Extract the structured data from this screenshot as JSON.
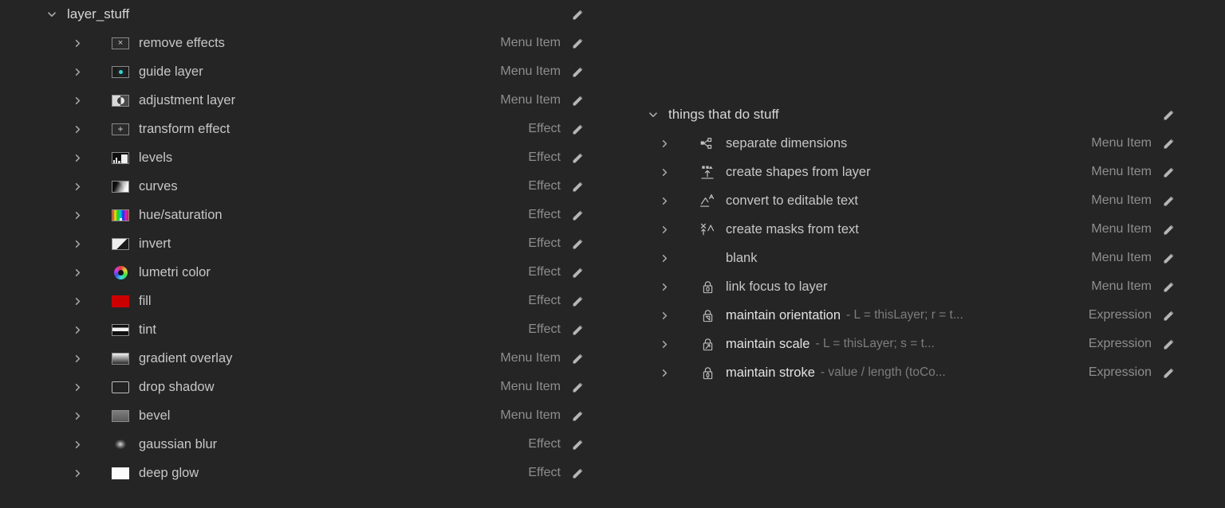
{
  "groups": {
    "left": {
      "name": "layer_stuff",
      "expanded": true,
      "edit_icon": "pencil-icon",
      "items": [
        {
          "label": "remove effects",
          "kind": "Menu Item",
          "icon": "remove-effects-icon"
        },
        {
          "label": "guide layer",
          "kind": "Menu Item",
          "icon": "guide-layer-icon"
        },
        {
          "label": "adjustment layer",
          "kind": "Menu Item",
          "icon": "adjustment-layer-icon"
        },
        {
          "label": "transform effect",
          "kind": "Effect",
          "icon": "transform-effect-icon"
        },
        {
          "label": "levels",
          "kind": "Effect",
          "icon": "levels-icon"
        },
        {
          "label": "curves",
          "kind": "Effect",
          "icon": "curves-icon"
        },
        {
          "label": "hue/saturation",
          "kind": "Effect",
          "icon": "hue-saturation-icon"
        },
        {
          "label": "invert",
          "kind": "Effect",
          "icon": "invert-icon"
        },
        {
          "label": "lumetri color",
          "kind": "Effect",
          "icon": "lumetri-color-icon"
        },
        {
          "label": "fill",
          "kind": "Effect",
          "icon": "fill-icon"
        },
        {
          "label": "tint",
          "kind": "Effect",
          "icon": "tint-icon"
        },
        {
          "label": "gradient overlay",
          "kind": "Menu Item",
          "icon": "gradient-overlay-icon"
        },
        {
          "label": "drop shadow",
          "kind": "Menu Item",
          "icon": "drop-shadow-icon"
        },
        {
          "label": "bevel",
          "kind": "Menu Item",
          "icon": "bevel-icon"
        },
        {
          "label": "gaussian blur",
          "kind": "Effect",
          "icon": "gaussian-blur-icon"
        },
        {
          "label": "deep glow",
          "kind": "Effect",
          "icon": "deep-glow-icon"
        }
      ]
    },
    "right": {
      "name": "things that do stuff",
      "expanded": true,
      "edit_icon": "pencil-icon",
      "items": [
        {
          "label": "separate dimensions",
          "kind": "Menu Item",
          "icon": "separate-dimensions-icon",
          "detail": ""
        },
        {
          "label": "create shapes from layer",
          "kind": "Menu Item",
          "icon": "create-shapes-icon",
          "detail": ""
        },
        {
          "label": "convert to editable text",
          "kind": "Menu Item",
          "icon": "convert-text-icon",
          "detail": ""
        },
        {
          "label": "create masks from text",
          "kind": "Menu Item",
          "icon": "create-masks-icon",
          "detail": ""
        },
        {
          "label": "blank",
          "kind": "Menu Item",
          "icon": "",
          "detail": ""
        },
        {
          "label": "link focus to layer",
          "kind": "Menu Item",
          "icon": "lock-focus-icon",
          "detail": ""
        },
        {
          "label": "maintain orientation",
          "kind": "Expression",
          "icon": "lock-orientation-icon",
          "detail": "- L = thisLayer; r = t..."
        },
        {
          "label": "maintain scale",
          "kind": "Expression",
          "icon": "lock-scale-icon",
          "detail": "- L = thisLayer; s = t..."
        },
        {
          "label": "maintain stroke",
          "kind": "Expression",
          "icon": "lock-stroke-icon",
          "detail": "- value / length (toCo..."
        }
      ]
    }
  },
  "colors": {
    "background": "#252525",
    "label": "#c7c7c7",
    "kind": "#8e8e8e",
    "expression": "#7d7d7d",
    "accent_guide": "#37d4d4",
    "accent_fill": "#cc0000"
  }
}
